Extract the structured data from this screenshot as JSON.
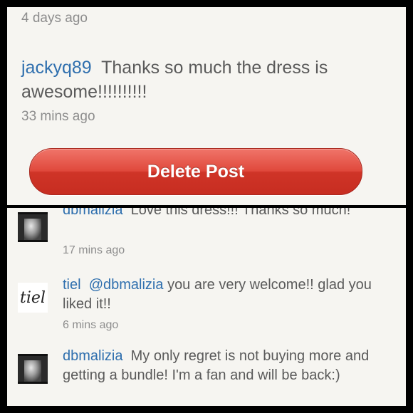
{
  "top": {
    "timestamp_prev": "4 days ago",
    "comment": {
      "username": "jackyq89",
      "text": "Thanks so much the dress is awesome!!!!!!!!!!",
      "time": "33 mins ago"
    },
    "delete_label": "Delete Post"
  },
  "comments": [
    {
      "username": "dbmalizia",
      "text": "Love this dress!!! Thanks so much!",
      "time": "17 mins ago",
      "avatar": "photo-avatar"
    },
    {
      "username": "tiel",
      "mention": "@dbmalizia",
      "text": "you are very welcome!! glad you liked it!!",
      "time": "6 mins ago",
      "avatar": "tiel-logo-avatar",
      "avatar_text": "tiel"
    },
    {
      "username": "dbmalizia",
      "text": "My only regret is not buying more and getting a bundle! I'm a fan and will be back:)",
      "avatar": "photo-avatar"
    }
  ],
  "colors": {
    "username": "#2f6fae",
    "delete_button": "#d93e31",
    "background": "#f6f5f1",
    "text": "#5a5a5a",
    "timestamp": "#8d8d8d"
  }
}
